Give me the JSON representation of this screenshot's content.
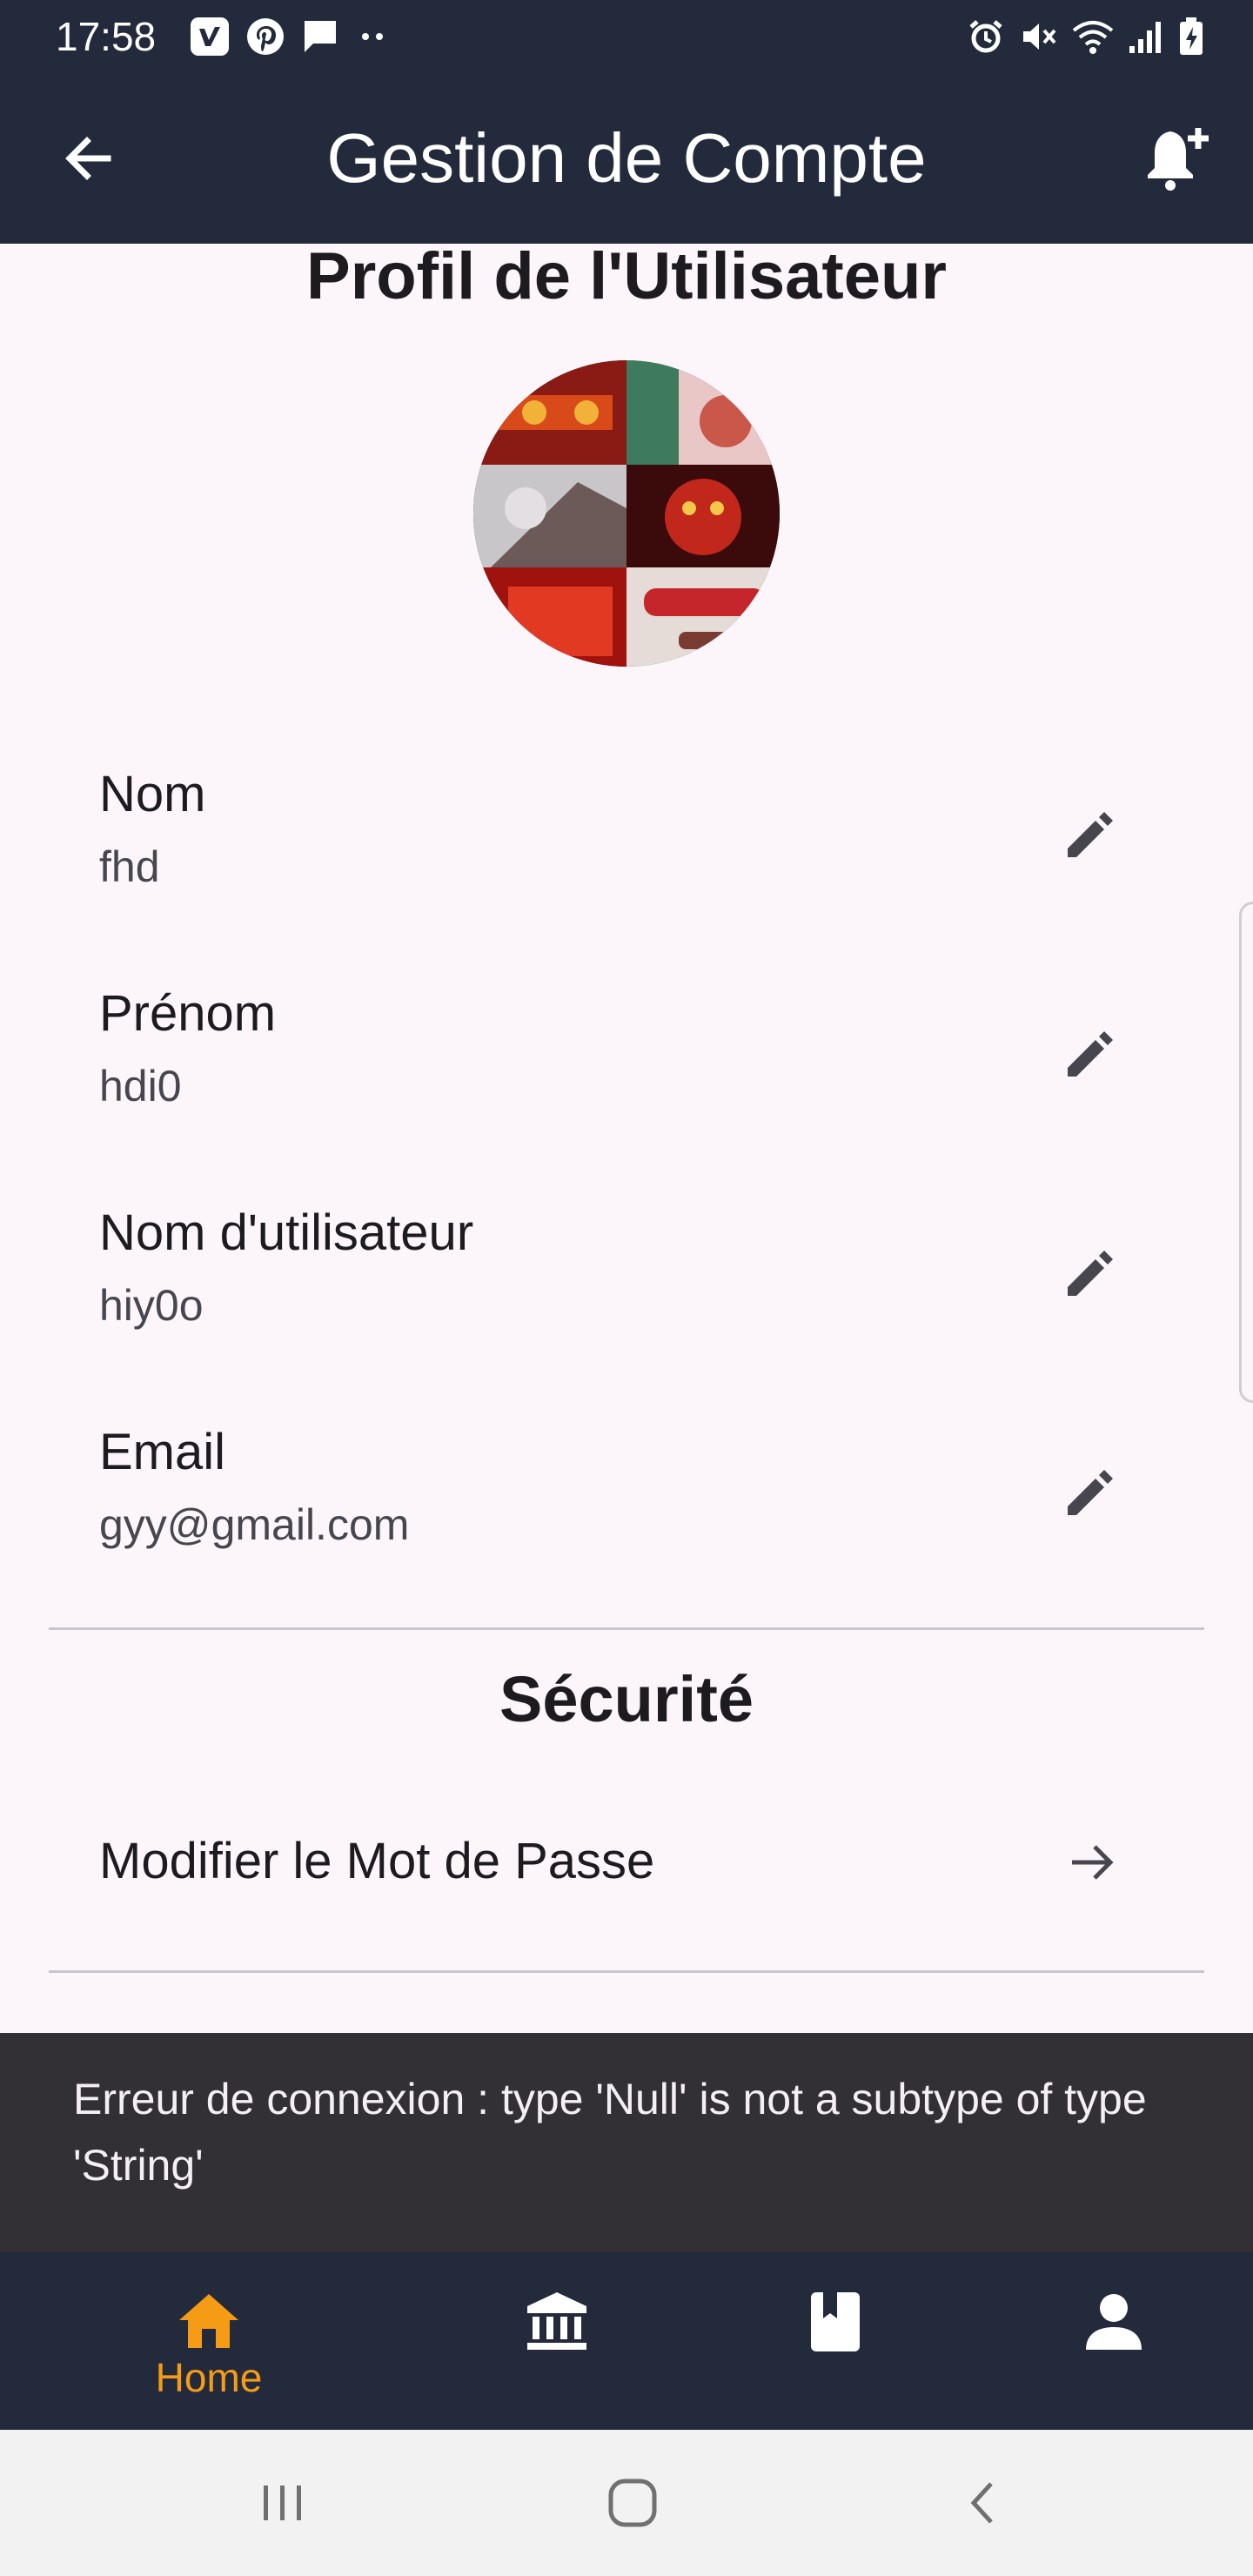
{
  "status_bar": {
    "time": "17:58",
    "left_icons": [
      "vimeo-icon",
      "pinterest-icon",
      "message-icon",
      "more-dots-icon"
    ],
    "right_icons": [
      "alarm-icon",
      "mute-icon",
      "wifi-icon",
      "signal-icon",
      "battery-charging-icon"
    ]
  },
  "app_bar": {
    "title": "Gestion de Compte",
    "back_icon": "arrow-back-icon",
    "action_icon": "notification-add-icon"
  },
  "profile": {
    "title": "Profil de l'Utilisateur",
    "fields": [
      {
        "label": "Nom",
        "value": "fhd"
      },
      {
        "label": "Prénom",
        "value": "hdi0"
      },
      {
        "label": "Nom d'utilisateur",
        "value": "hiy0o"
      },
      {
        "label": "Email",
        "value": "gyy@gmail.com"
      }
    ]
  },
  "security": {
    "title": "Sécurité",
    "change_password_label": "Modifier le Mot de Passe"
  },
  "snackbar": {
    "message": "Erreur de connexion : type 'Null' is not a subtype of type 'String'"
  },
  "bottom_nav": {
    "items": [
      {
        "label": "Home",
        "icon": "home-icon",
        "active": true
      },
      {
        "label": "",
        "icon": "bank-icon",
        "active": false
      },
      {
        "label": "",
        "icon": "book-icon",
        "active": false
      },
      {
        "label": "",
        "icon": "person-icon",
        "active": false
      }
    ]
  },
  "system_nav": {
    "buttons": [
      "recents-icon",
      "home-circle-icon",
      "back-chevron-icon"
    ]
  },
  "colors": {
    "app_bar": "#222a3c",
    "background": "#fcf6fb",
    "accent": "#f59b16",
    "snackbar": "#322f35"
  }
}
